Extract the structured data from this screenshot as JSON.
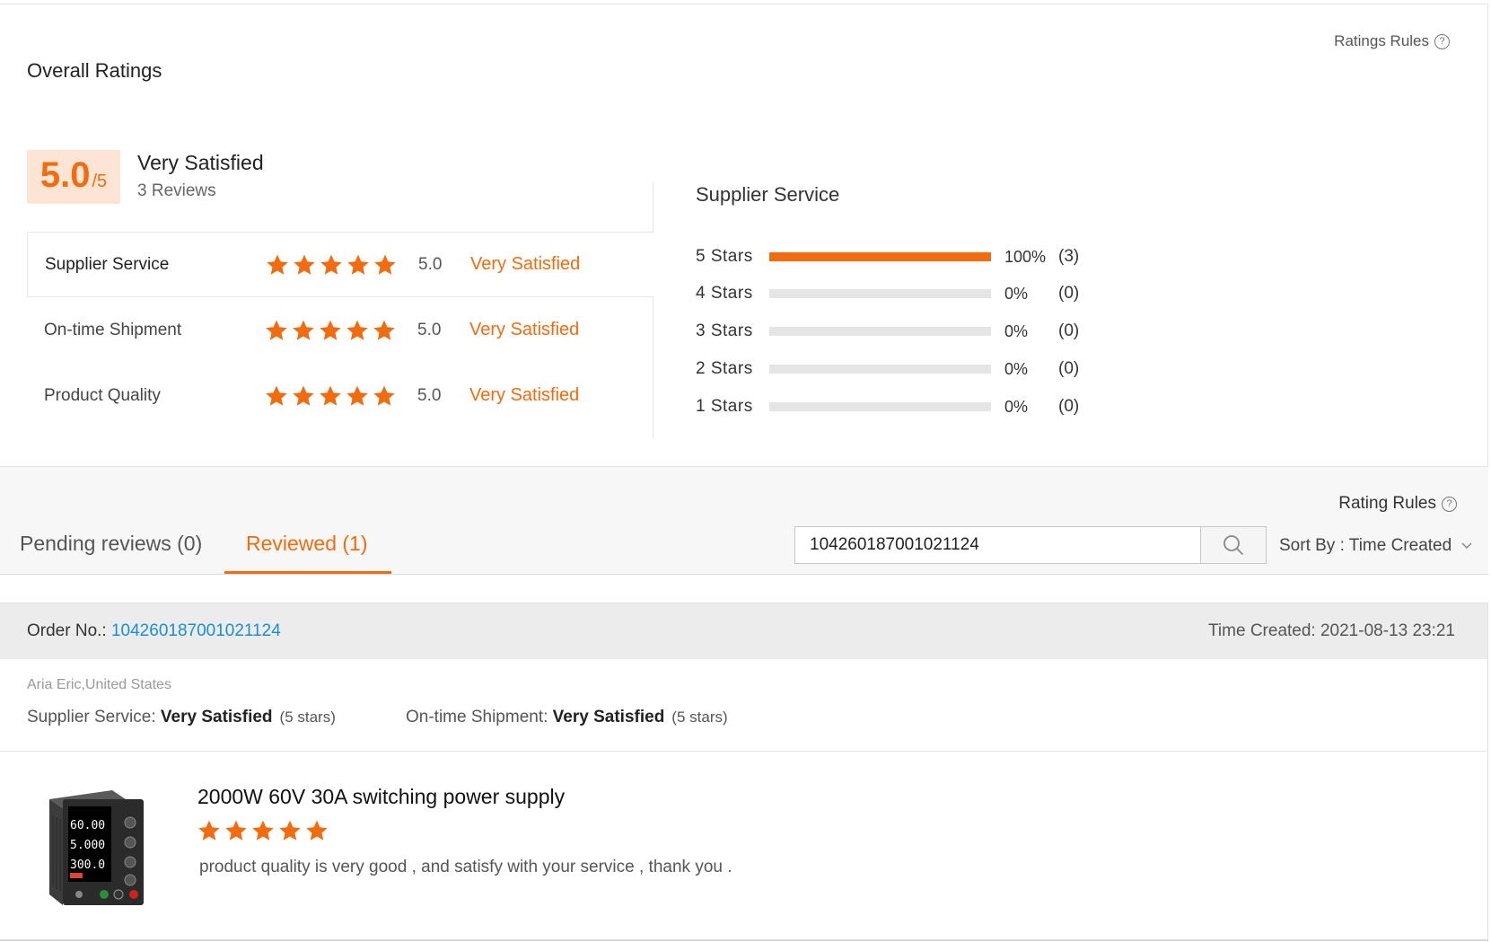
{
  "header": {
    "ratings_rules": "Ratings Rules",
    "title": "Overall Ratings"
  },
  "summary": {
    "score": "5.0",
    "score_suffix": "/5",
    "label": "Very Satisfied",
    "reviews": "3 Reviews"
  },
  "categories": [
    {
      "name": "Supplier Service",
      "value": "5.0",
      "verdict": "Very Satisfied",
      "stars": 5
    },
    {
      "name": "On-time Shipment",
      "value": "5.0",
      "verdict": "Very Satisfied",
      "stars": 5
    },
    {
      "name": "Product Quality",
      "value": "5.0",
      "verdict": "Very Satisfied",
      "stars": 5
    }
  ],
  "distribution": {
    "title": "Supplier Service",
    "rows": [
      {
        "label": "5  Stars",
        "percent": "100%",
        "count": "(3)",
        "fill": 1.0
      },
      {
        "label": "4  Stars",
        "percent": "0%",
        "count": "(0)",
        "fill": 0
      },
      {
        "label": "3  Stars",
        "percent": "0%",
        "count": "(0)",
        "fill": 0
      },
      {
        "label": "2  Stars",
        "percent": "0%",
        "count": "(0)",
        "fill": 0
      },
      {
        "label": "1  Stars",
        "percent": "0%",
        "count": "(0)",
        "fill": 0
      }
    ]
  },
  "tabs": {
    "rating_rules": "Rating Rules",
    "pending": "Pending reviews (0)",
    "reviewed": "Reviewed (1)",
    "search_value": "104260187001021124",
    "sort_by": "Sort By : Time Created"
  },
  "order": {
    "label": "Order No.: ",
    "number": "104260187001021124",
    "time_created": "Time Created: 2021-08-13 23:21",
    "reviewer": "Aria Eric,United States",
    "supplier_label": "Supplier Service: ",
    "supplier_value": "Very Satisfied",
    "supplier_stars": "(5 stars)",
    "shipment_label": "On-time Shipment: ",
    "shipment_value": "Very Satisfied",
    "shipment_stars": "(5 stars)"
  },
  "product": {
    "title": "2000W 60V 30A switching power supply",
    "stars": 5,
    "comment": "product quality is very good , and satisfy with your service , thank you .",
    "display_values": [
      "60.00",
      "5.000",
      "300.0"
    ]
  },
  "colors": {
    "accent": "#f26b0f",
    "link": "#1a8fd0"
  }
}
